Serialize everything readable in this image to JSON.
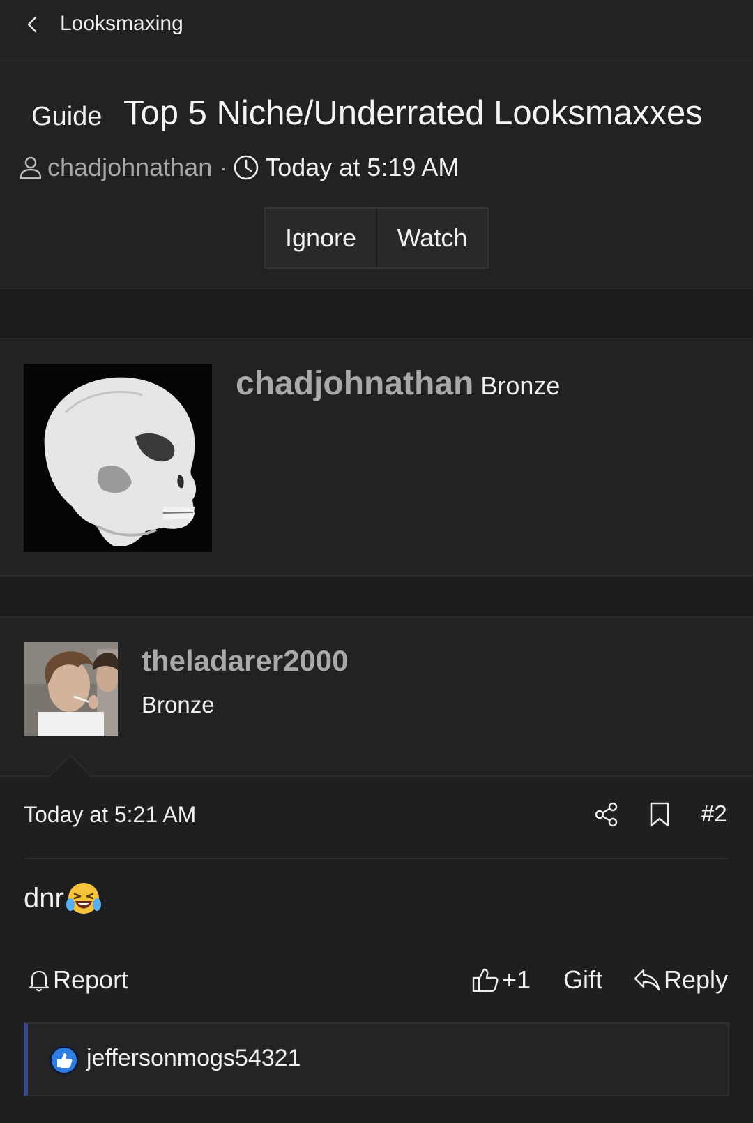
{
  "topbar": {
    "breadcrumb": "Looksmaxing",
    "back_icon": "chevron-left-icon"
  },
  "thread": {
    "prefix": "Guide",
    "title": "Top 5 Niche/Underrated Looksmaxxes",
    "author": "chadjohnathan",
    "separator": "·",
    "date": "Today at 5:19 AM",
    "buttons": {
      "ignore": "Ignore",
      "watch": "Watch"
    }
  },
  "op_card": {
    "username": "chadjohnathan",
    "rank": "Bronze"
  },
  "post": {
    "username": "theladarer2000",
    "rank": "Bronze",
    "date": "Today at 5:21 AM",
    "number": "#2",
    "message": "dnr",
    "emoji": "face-with-tears-of-joy",
    "actions": {
      "report": "Report",
      "like": "+1",
      "gift": "Gift",
      "reply": "Reply"
    },
    "reactions": {
      "users": "jeffersonmogs54321"
    }
  },
  "colors": {
    "background": "#1c1c1d",
    "panel": "#222223",
    "muted_text": "#a9a9a9",
    "accent": "#3a4a8c",
    "like_blue": "#2f7de1"
  }
}
